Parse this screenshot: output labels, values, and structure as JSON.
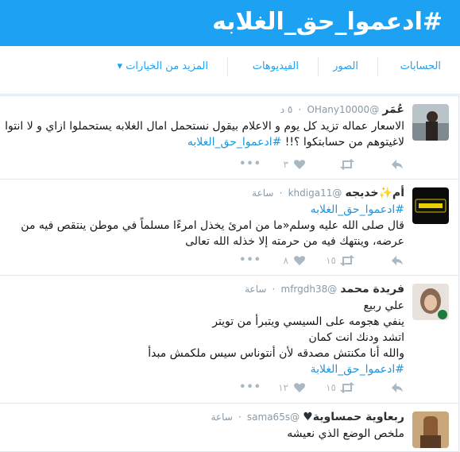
{
  "header": {
    "title": "#ادعموا_حق_الغلابه"
  },
  "nav": {
    "accounts": "الحسابات",
    "photos": "الصور",
    "videos": "الفيديوهات",
    "more": "المزيد من الخيارات ▾"
  },
  "colors": {
    "brand": "#1da1f2",
    "link": "#1b95e0",
    "heart": "#e0245e"
  },
  "tweets": [
    {
      "name": "عُمَر",
      "handle": "@OHany10000",
      "time": "٥ د",
      "lines": [
        "الاسعار عماله تزيد كل يوم و الاعلام بيقول نستحمل امال الغلابه يستحملوا ازاي و لا انتوا",
        "لاغيتوهم من حسابتكوا ؟!!"
      ],
      "hashtag": "#ادعموا_حق_الغلابه",
      "likes": "٣",
      "retweets": ""
    },
    {
      "name": "أم✨خديجه",
      "handle": "@khdiga11",
      "time": "ساعة",
      "hashtag": "#ادعموا_حق_الغلابه",
      "lines": [
        "قال صلى الله عليه وسلم«ما من امرئ يخذل امرءًا مسلماً في موطن ينتقص فيه من",
        "عرضه، وينتهك فيه من حرمته إلا خذله الله تعالى"
      ],
      "likes": "٨",
      "retweets": "١٥"
    },
    {
      "name": "فريدة محمد",
      "handle": "@mfrgdh38",
      "time": "ساعة",
      "lines": [
        "علي ربيع",
        "ينفي هجومه على السيسي ويتبرأ من تويتر",
        "اتشد ودنك انت كمان",
        "والله أنا مكنتش مصدقه لأن أنتوناس سيس ملكمش مبدأ"
      ],
      "hashtag": "#ادعموا_حق_الغلابة",
      "likes": "١٢",
      "retweets": "١٥"
    },
    {
      "name": "ربعاوية حمساوية♥",
      "handle": "@sama65s",
      "time": "ساعة",
      "lines": [
        "ملخص الوضع الذي نعيشه"
      ]
    }
  ]
}
